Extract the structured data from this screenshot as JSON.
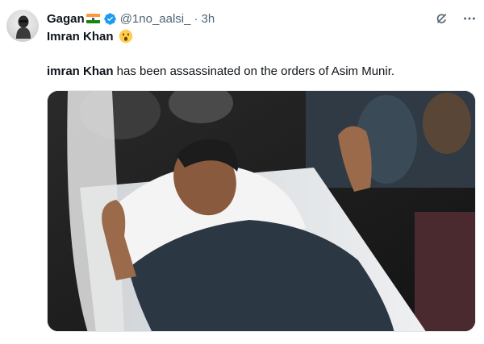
{
  "tweet": {
    "author_name": "Gagan",
    "author_handle": "@1no_aalsi_",
    "separator": "·",
    "time": "3h",
    "title": "Imran Khan",
    "body_bold": "imran Khan",
    "body_rest": " has been assassinated on the orders of Asim Munir.",
    "icons": {
      "verified": "verified-badge-icon",
      "grok": "grok-icon",
      "more": "more-icon",
      "flag": "india-flag-icon",
      "face": "astonished-face-icon"
    },
    "colors": {
      "verified": "#1d9bf0",
      "secondary_text": "#536471"
    }
  }
}
